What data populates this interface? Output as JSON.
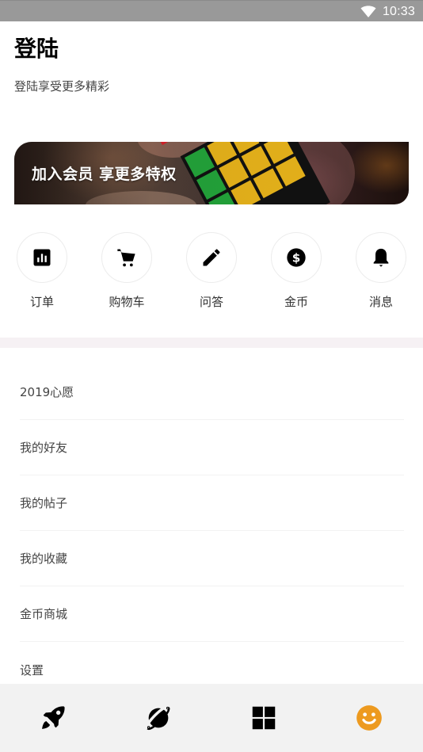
{
  "status_bar": {
    "time": "10:33",
    "wifi_icon": "wifi-icon"
  },
  "header": {
    "title": "登陆",
    "subtitle": "登陆享受更多精彩"
  },
  "banner": {
    "text": "加入会员  享更多特权"
  },
  "quick_actions": [
    {
      "label": "订单",
      "icon": "bar-chart-icon"
    },
    {
      "label": "购物车",
      "icon": "shopping-cart-icon"
    },
    {
      "label": "问答",
      "icon": "pencil-icon"
    },
    {
      "label": "金币",
      "icon": "dollar-coin-icon"
    },
    {
      "label": "消息",
      "icon": "bell-icon"
    }
  ],
  "menu": [
    {
      "label": "2019心愿"
    },
    {
      "label": "我的好友"
    },
    {
      "label": "我的帖子"
    },
    {
      "label": "我的收藏"
    },
    {
      "label": "金币商城"
    },
    {
      "label": "设置"
    }
  ],
  "tab_bar": {
    "active_index": 3,
    "active_color": "#ED9A1F",
    "tabs": [
      {
        "icon": "rocket-icon"
      },
      {
        "icon": "planet-icon"
      },
      {
        "icon": "grid-icon"
      },
      {
        "icon": "smiley-icon"
      }
    ]
  }
}
